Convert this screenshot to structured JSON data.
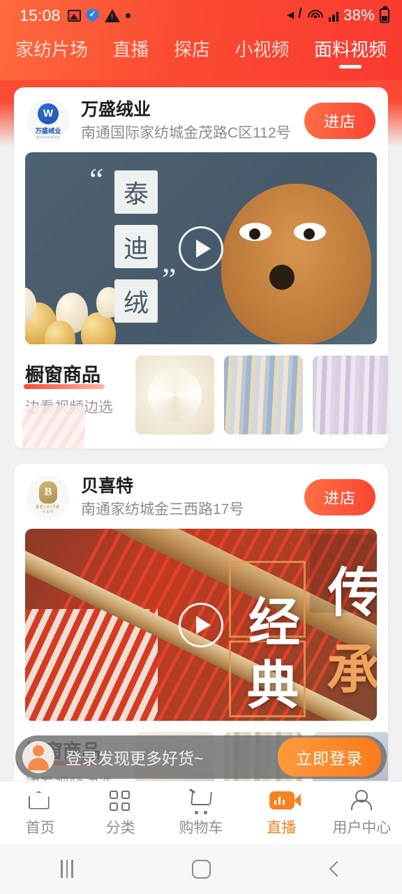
{
  "status_bar": {
    "time": "15:08",
    "battery_percent": "38%",
    "left_icons": [
      "photo-icon",
      "shield-icon",
      "warning-icon",
      "dot-icon"
    ],
    "right_icons": [
      "mute-icon",
      "wifi-icon",
      "signal-icon",
      "battery-icon"
    ]
  },
  "top_tabs": {
    "items": [
      {
        "label": "家纺片场",
        "active": false
      },
      {
        "label": "直播",
        "active": false
      },
      {
        "label": "探店",
        "active": false
      },
      {
        "label": "小视频",
        "active": false
      },
      {
        "label": "面料视频",
        "active": true
      }
    ]
  },
  "cards": [
    {
      "shop_name": "万盛绒业",
      "shop_address": "南通国际家纺城金茂路C区112号",
      "enter_label": "进店",
      "logo_text": "万盛绒业",
      "logo_sub": "WANSHENG",
      "video": {
        "stamp_chars": [
          "泰",
          "迪",
          "绒"
        ],
        "quote_open": "“",
        "quote_close": "”",
        "play_label": "play-icon"
      },
      "showcase": {
        "title": "橱窗商品",
        "subtitle": "边看视频边选",
        "thumbs": [
          "white-fleece-fabric",
          "colorful-fabric-rolls",
          "pastel-fabric-rolls"
        ]
      }
    },
    {
      "shop_name": "贝喜特",
      "shop_address": "南通家纺城金三西路17号",
      "enter_label": "进店",
      "logo_text": "BEIXITE",
      "logo_sub": "贝喜特",
      "video": {
        "overlay_words": [
          "经",
          "典",
          "传",
          "承"
        ],
        "play_label": "play-icon"
      },
      "showcase": {
        "title": "橱窗商品",
        "subtitle": "边看视频边选",
        "thumbs": [
          "bedding-set-photo",
          "fabric-stack-photo",
          "quilt-fabric-photo"
        ]
      }
    }
  ],
  "login_banner": {
    "message": "登录发现更多好货~",
    "button_label": "立即登录",
    "avatar": "user-avatar-icon"
  },
  "bottom_nav": {
    "items": [
      {
        "label": "首页",
        "icon": "home-icon",
        "active": false
      },
      {
        "label": "分类",
        "icon": "grid-icon",
        "active": false
      },
      {
        "label": "购物车",
        "icon": "cart-icon",
        "active": false
      },
      {
        "label": "直播",
        "icon": "live-video-icon",
        "active": true
      },
      {
        "label": "用户中心",
        "icon": "user-icon",
        "active": false
      }
    ]
  },
  "android_nav": {
    "recents": "recents-icon",
    "home": "home-button-icon",
    "back": "back-icon"
  },
  "colors": {
    "brand_red": "#fb4b33",
    "accent_orange": "#f5811f",
    "header_gradient_start": "#ff6a3d",
    "header_gradient_end": "#f93a2f"
  }
}
